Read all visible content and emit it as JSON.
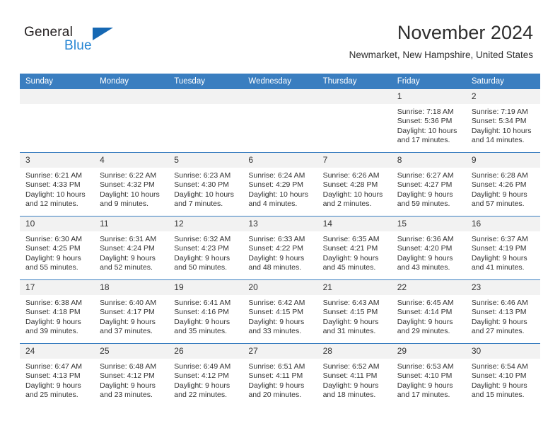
{
  "brand": {
    "name_top": "General",
    "name_bottom": "Blue",
    "triangle_color": "#1668b3",
    "blue_color": "#2585d3",
    "dark_color": "#231f20"
  },
  "header": {
    "month_title": "November 2024",
    "location": "Newmarket, New Hampshire, United States",
    "header_bg": "#3a7ec0",
    "daynum_bg": "#f2f2f2"
  },
  "calendar": {
    "weekday_headers": [
      "Sunday",
      "Monday",
      "Tuesday",
      "Wednesday",
      "Thursday",
      "Friday",
      "Saturday"
    ],
    "weeks": [
      [
        {
          "day": "",
          "empty": true,
          "lines": []
        },
        {
          "day": "",
          "empty": true,
          "lines": []
        },
        {
          "day": "",
          "empty": true,
          "lines": []
        },
        {
          "day": "",
          "empty": true,
          "lines": []
        },
        {
          "day": "",
          "empty": true,
          "lines": []
        },
        {
          "day": "1",
          "empty": false,
          "lines": [
            "Sunrise: 7:18 AM",
            "Sunset: 5:36 PM",
            "Daylight: 10 hours",
            "and 17 minutes."
          ]
        },
        {
          "day": "2",
          "empty": false,
          "lines": [
            "Sunrise: 7:19 AM",
            "Sunset: 5:34 PM",
            "Daylight: 10 hours",
            "and 14 minutes."
          ]
        }
      ],
      [
        {
          "day": "3",
          "empty": false,
          "lines": [
            "Sunrise: 6:21 AM",
            "Sunset: 4:33 PM",
            "Daylight: 10 hours",
            "and 12 minutes."
          ]
        },
        {
          "day": "4",
          "empty": false,
          "lines": [
            "Sunrise: 6:22 AM",
            "Sunset: 4:32 PM",
            "Daylight: 10 hours",
            "and 9 minutes."
          ]
        },
        {
          "day": "5",
          "empty": false,
          "lines": [
            "Sunrise: 6:23 AM",
            "Sunset: 4:30 PM",
            "Daylight: 10 hours",
            "and 7 minutes."
          ]
        },
        {
          "day": "6",
          "empty": false,
          "lines": [
            "Sunrise: 6:24 AM",
            "Sunset: 4:29 PM",
            "Daylight: 10 hours",
            "and 4 minutes."
          ]
        },
        {
          "day": "7",
          "empty": false,
          "lines": [
            "Sunrise: 6:26 AM",
            "Sunset: 4:28 PM",
            "Daylight: 10 hours",
            "and 2 minutes."
          ]
        },
        {
          "day": "8",
          "empty": false,
          "lines": [
            "Sunrise: 6:27 AM",
            "Sunset: 4:27 PM",
            "Daylight: 9 hours",
            "and 59 minutes."
          ]
        },
        {
          "day": "9",
          "empty": false,
          "lines": [
            "Sunrise: 6:28 AM",
            "Sunset: 4:26 PM",
            "Daylight: 9 hours",
            "and 57 minutes."
          ]
        }
      ],
      [
        {
          "day": "10",
          "empty": false,
          "lines": [
            "Sunrise: 6:30 AM",
            "Sunset: 4:25 PM",
            "Daylight: 9 hours",
            "and 55 minutes."
          ]
        },
        {
          "day": "11",
          "empty": false,
          "lines": [
            "Sunrise: 6:31 AM",
            "Sunset: 4:24 PM",
            "Daylight: 9 hours",
            "and 52 minutes."
          ]
        },
        {
          "day": "12",
          "empty": false,
          "lines": [
            "Sunrise: 6:32 AM",
            "Sunset: 4:23 PM",
            "Daylight: 9 hours",
            "and 50 minutes."
          ]
        },
        {
          "day": "13",
          "empty": false,
          "lines": [
            "Sunrise: 6:33 AM",
            "Sunset: 4:22 PM",
            "Daylight: 9 hours",
            "and 48 minutes."
          ]
        },
        {
          "day": "14",
          "empty": false,
          "lines": [
            "Sunrise: 6:35 AM",
            "Sunset: 4:21 PM",
            "Daylight: 9 hours",
            "and 45 minutes."
          ]
        },
        {
          "day": "15",
          "empty": false,
          "lines": [
            "Sunrise: 6:36 AM",
            "Sunset: 4:20 PM",
            "Daylight: 9 hours",
            "and 43 minutes."
          ]
        },
        {
          "day": "16",
          "empty": false,
          "lines": [
            "Sunrise: 6:37 AM",
            "Sunset: 4:19 PM",
            "Daylight: 9 hours",
            "and 41 minutes."
          ]
        }
      ],
      [
        {
          "day": "17",
          "empty": false,
          "lines": [
            "Sunrise: 6:38 AM",
            "Sunset: 4:18 PM",
            "Daylight: 9 hours",
            "and 39 minutes."
          ]
        },
        {
          "day": "18",
          "empty": false,
          "lines": [
            "Sunrise: 6:40 AM",
            "Sunset: 4:17 PM",
            "Daylight: 9 hours",
            "and 37 minutes."
          ]
        },
        {
          "day": "19",
          "empty": false,
          "lines": [
            "Sunrise: 6:41 AM",
            "Sunset: 4:16 PM",
            "Daylight: 9 hours",
            "and 35 minutes."
          ]
        },
        {
          "day": "20",
          "empty": false,
          "lines": [
            "Sunrise: 6:42 AM",
            "Sunset: 4:15 PM",
            "Daylight: 9 hours",
            "and 33 minutes."
          ]
        },
        {
          "day": "21",
          "empty": false,
          "lines": [
            "Sunrise: 6:43 AM",
            "Sunset: 4:15 PM",
            "Daylight: 9 hours",
            "and 31 minutes."
          ]
        },
        {
          "day": "22",
          "empty": false,
          "lines": [
            "Sunrise: 6:45 AM",
            "Sunset: 4:14 PM",
            "Daylight: 9 hours",
            "and 29 minutes."
          ]
        },
        {
          "day": "23",
          "empty": false,
          "lines": [
            "Sunrise: 6:46 AM",
            "Sunset: 4:13 PM",
            "Daylight: 9 hours",
            "and 27 minutes."
          ]
        }
      ],
      [
        {
          "day": "24",
          "empty": false,
          "lines": [
            "Sunrise: 6:47 AM",
            "Sunset: 4:13 PM",
            "Daylight: 9 hours",
            "and 25 minutes."
          ]
        },
        {
          "day": "25",
          "empty": false,
          "lines": [
            "Sunrise: 6:48 AM",
            "Sunset: 4:12 PM",
            "Daylight: 9 hours",
            "and 23 minutes."
          ]
        },
        {
          "day": "26",
          "empty": false,
          "lines": [
            "Sunrise: 6:49 AM",
            "Sunset: 4:12 PM",
            "Daylight: 9 hours",
            "and 22 minutes."
          ]
        },
        {
          "day": "27",
          "empty": false,
          "lines": [
            "Sunrise: 6:51 AM",
            "Sunset: 4:11 PM",
            "Daylight: 9 hours",
            "and 20 minutes."
          ]
        },
        {
          "day": "28",
          "empty": false,
          "lines": [
            "Sunrise: 6:52 AM",
            "Sunset: 4:11 PM",
            "Daylight: 9 hours",
            "and 18 minutes."
          ]
        },
        {
          "day": "29",
          "empty": false,
          "lines": [
            "Sunrise: 6:53 AM",
            "Sunset: 4:10 PM",
            "Daylight: 9 hours",
            "and 17 minutes."
          ]
        },
        {
          "day": "30",
          "empty": false,
          "lines": [
            "Sunrise: 6:54 AM",
            "Sunset: 4:10 PM",
            "Daylight: 9 hours",
            "and 15 minutes."
          ]
        }
      ]
    ]
  }
}
